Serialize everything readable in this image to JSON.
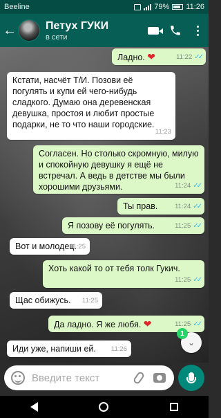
{
  "status_bar": {
    "carrier": "Beeline",
    "battery": "79%",
    "time": "11:26"
  },
  "header": {
    "contact_name": "Петух ГУКИ",
    "status": "в сети",
    "back_icon": "arrow-left-icon",
    "call_icons": [
      "video-call-icon",
      "phone-icon",
      "menu-dots-icon"
    ]
  },
  "messages": [
    {
      "dir": "out",
      "text": "Ладно.",
      "emoji": "❤",
      "time": "11:22",
      "read": true
    },
    {
      "dir": "in",
      "text": "Кстати, насчёт Т/И. Позови её погулять и купи ей чего-нибудь сладкого. Думаю она деревенская девушка, простоя и любит простые подарки, не то что наши городские.",
      "time": "11:23"
    },
    {
      "dir": "out",
      "text": "Согласен. Но столько скромную, милую и спокойную девушку я ещё не встречал. А ведь в детстве мы были хорошими друзьями.",
      "time": "11:24",
      "read": true
    },
    {
      "dir": "out",
      "text": "Ты прав.",
      "time": "11:24",
      "read": true
    },
    {
      "dir": "out",
      "text": "Я позову её погулять.",
      "time": "11:25",
      "read": true
    },
    {
      "dir": "in",
      "text": "Вот и молодец.",
      "time": "11:25"
    },
    {
      "dir": "out",
      "text": "Хоть какой то от тебя толк Гукич.",
      "time": "11:25",
      "read": true
    },
    {
      "dir": "in",
      "text": "Щас обижусь.",
      "time": "11:25"
    },
    {
      "dir": "out",
      "text": "Да ладно. Я же любя.",
      "emoji": "❤",
      "time": "11:25",
      "read": true
    },
    {
      "dir": "in",
      "text": "Иди уже, напиши ей.",
      "time": "11:26"
    }
  ],
  "unread_count": "1",
  "composer": {
    "placeholder": "Введите текст"
  },
  "colors": {
    "header": "#075e54",
    "outgoing": "#dcf8c6",
    "incoming": "#ffffff",
    "mic_button": "#00897b",
    "read_ticks": "#34b7f1"
  }
}
